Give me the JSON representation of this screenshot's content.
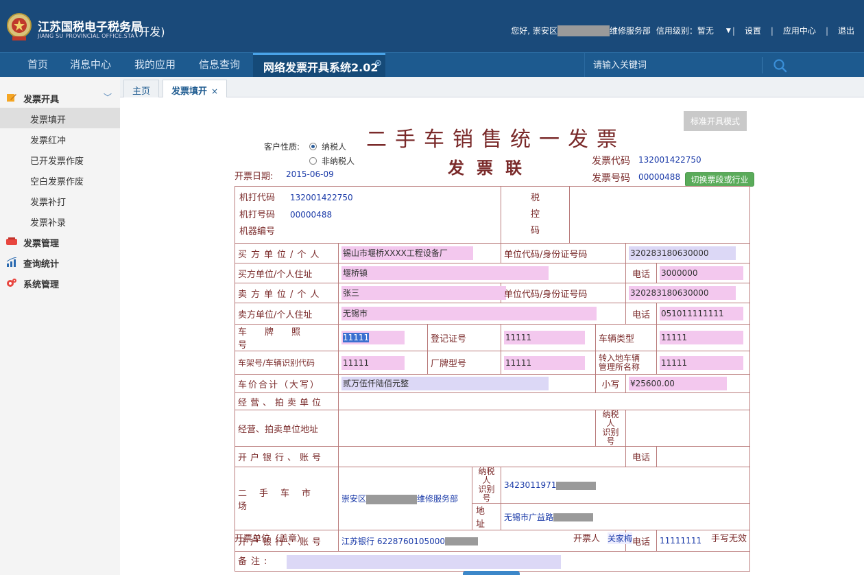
{
  "header": {
    "title": "江苏国税电子税务局",
    "subtitle": "JIANG SU PROVINCIAL OFFICE.STA",
    "env": "(开发)",
    "greeting": "您好, 崇安区",
    "org_suffix": "维修服务部",
    "credit": "信用级别：暂无",
    "settings": "设置",
    "app_center": "应用中心",
    "logout": "退出"
  },
  "nav": {
    "items": [
      "首页",
      "消息中心",
      "我的应用",
      "信息查询"
    ],
    "active": "网络发票开具系统2.02",
    "search_placeholder": "请输入关键词"
  },
  "sidebar": {
    "group1": "发票开具",
    "sub": [
      "发票填开",
      "发票红冲",
      "已开发票作废",
      "空白发票作废",
      "发票补打",
      "发票补录"
    ],
    "group2": "发票管理",
    "group3": "查询统计",
    "group4": "系统管理"
  },
  "tabs": {
    "home": "主页",
    "active": "发票填开",
    "close": "×"
  },
  "invoice": {
    "title": "二手车销售统一发票",
    "subtitle": "发票联",
    "std_mode": "标准开具模式",
    "customer_label": "客户性质:",
    "radio_taxpayer": "纳税人",
    "radio_non": "非纳税人",
    "date_label": "开票日期:",
    "date": "2015-06-09",
    "code_label": "发票代码",
    "code": "132001422750",
    "number_label": "发票号码",
    "number": "00000488",
    "switch_btn": "切换票段或行业",
    "machine_code_label": "机打代码",
    "machine_code": "132001422750",
    "machine_no_label": "机打号码",
    "machine_no": "00000488",
    "machine_id_label": "机器编号",
    "tax_ctrl": "税控码",
    "buyer_label": "买方单位/个人",
    "buyer": "锡山市堰桥XXXX工程设备厂",
    "id_label": "单位代码/身份证号码",
    "buyer_id": "320283180630000",
    "buyer_addr_label": "买方单位/个人住址",
    "buyer_addr": "堰桥镇",
    "phone_label": "电话",
    "buyer_phone": "3000000",
    "seller_label": "卖方单位/个人",
    "seller": "张三",
    "seller_id": "320283180630000",
    "seller_addr_label": "卖方单位/个人住址",
    "seller_addr": "无锡市",
    "seller_phone": "051011111111",
    "plate_label": "车牌照号",
    "plate": "11111",
    "reg_label": "登记证号",
    "reg": "11111",
    "vtype_label": "车辆类型",
    "vtype": "11111",
    "vin_label": "车架号/车辆识别代码",
    "vin": "11111",
    "model_label": "厂牌型号",
    "model": "11111",
    "transfer_label1": "转入地车辆",
    "transfer_label2": "管理所名称",
    "transfer": "11111",
    "total_label": "车价合计（大写）",
    "total_cn": "贰万伍仟陆佰元整",
    "small_label": "小写",
    "total_num": "¥25600.00",
    "dealer_label": "经营、拍卖单位",
    "dealer_addr_label": "经营、拍卖单位地址",
    "taxid_label1": "纳税人",
    "taxid_label2": "识别号",
    "bank_label": "开户银行、账号",
    "market_label": "二手车市场",
    "market_prefix": "崇安区",
    "market_suffix": "维修服务部",
    "market_taxid": "3423011971",
    "addr_label": "地址",
    "market_addr": "无锡市广益路",
    "market_bank": "江苏银行 6228760105000",
    "market_phone": "11111111",
    "remark_label": "备注:",
    "issuer_unit": "开票单位（盖章）",
    "issuer_label": "开票人",
    "issuer": "关家梅",
    "handwrite": "手写无效"
  },
  "colors": {
    "header": "#1a4a7a",
    "nav": "#1d5a8f",
    "invoice_red": "#7a2a2a",
    "field_pink": "#f3c8ee",
    "field_lavender": "#dcd8f6"
  }
}
